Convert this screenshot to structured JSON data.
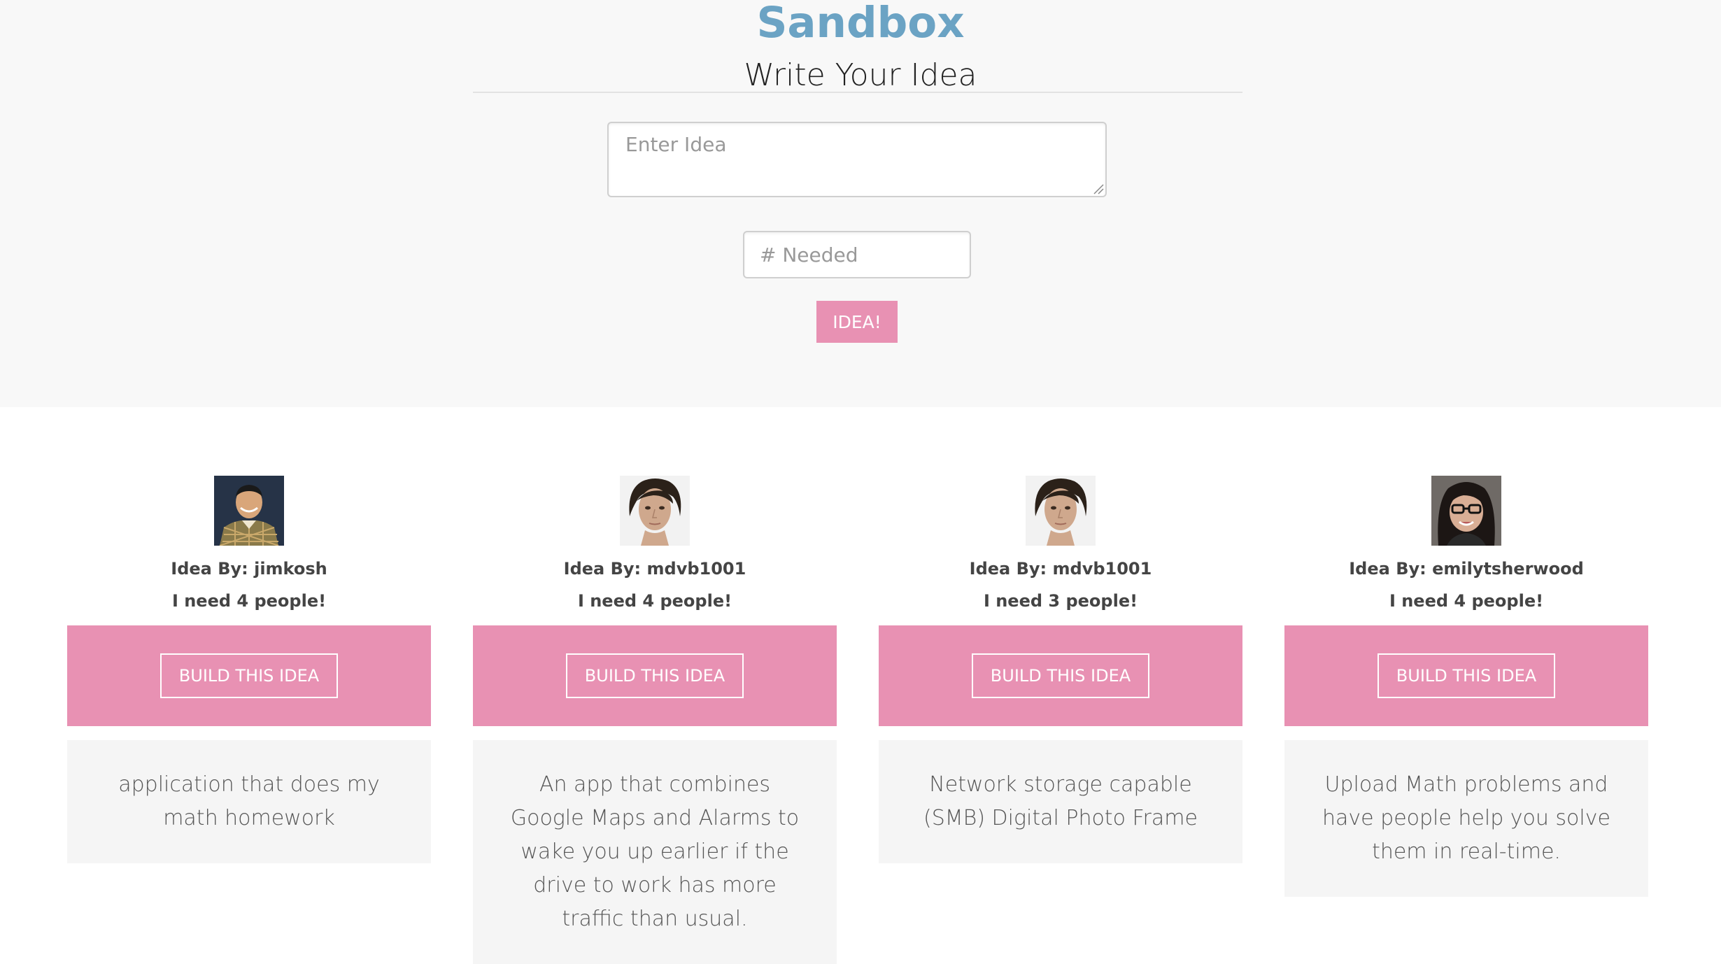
{
  "header": {
    "brand": "Sandbox",
    "subtitle": "Write Your Idea"
  },
  "form": {
    "idea_placeholder": "Enter Idea",
    "needed_placeholder": "# Needed",
    "submit_label": "IDEA!"
  },
  "ideas": [
    {
      "author_prefix": "Idea By: ",
      "author": "jimkosh",
      "need_prefix": "I need ",
      "count": "4",
      "need_suffix": " people!",
      "build_label": "BUILD THIS IDEA",
      "description": "application that does my math homework",
      "avatar_icon": "user-photo-icon"
    },
    {
      "author_prefix": "Idea By: ",
      "author": "mdvb1001",
      "need_prefix": "I need ",
      "count": "4",
      "need_suffix": " people!",
      "build_label": "BUILD THIS IDEA",
      "description": "An app that combines Google Maps and Alarms to wake you up earlier if the drive to work has more traffic than usual.",
      "avatar_icon": "user-photo-icon"
    },
    {
      "author_prefix": "Idea By: ",
      "author": "mdvb1001",
      "need_prefix": "I need ",
      "count": "3",
      "need_suffix": " people!",
      "build_label": "BUILD THIS IDEA",
      "description": "Network storage capable (SMB) Digital Photo Frame",
      "avatar_icon": "user-photo-icon"
    },
    {
      "author_prefix": "Idea By: ",
      "author": "emilytsherwood",
      "need_prefix": "I need ",
      "count": "4",
      "need_suffix": " people!",
      "build_label": "BUILD THIS IDEA",
      "description": "Upload Math problems and have people help you solve them in real-time.",
      "avatar_icon": "user-photo-icon"
    }
  ],
  "colors": {
    "brand": "#6ba3c4",
    "accent": "#e891b3",
    "hero_bg": "#f8f8f8",
    "card_bg": "#f5f5f5"
  }
}
